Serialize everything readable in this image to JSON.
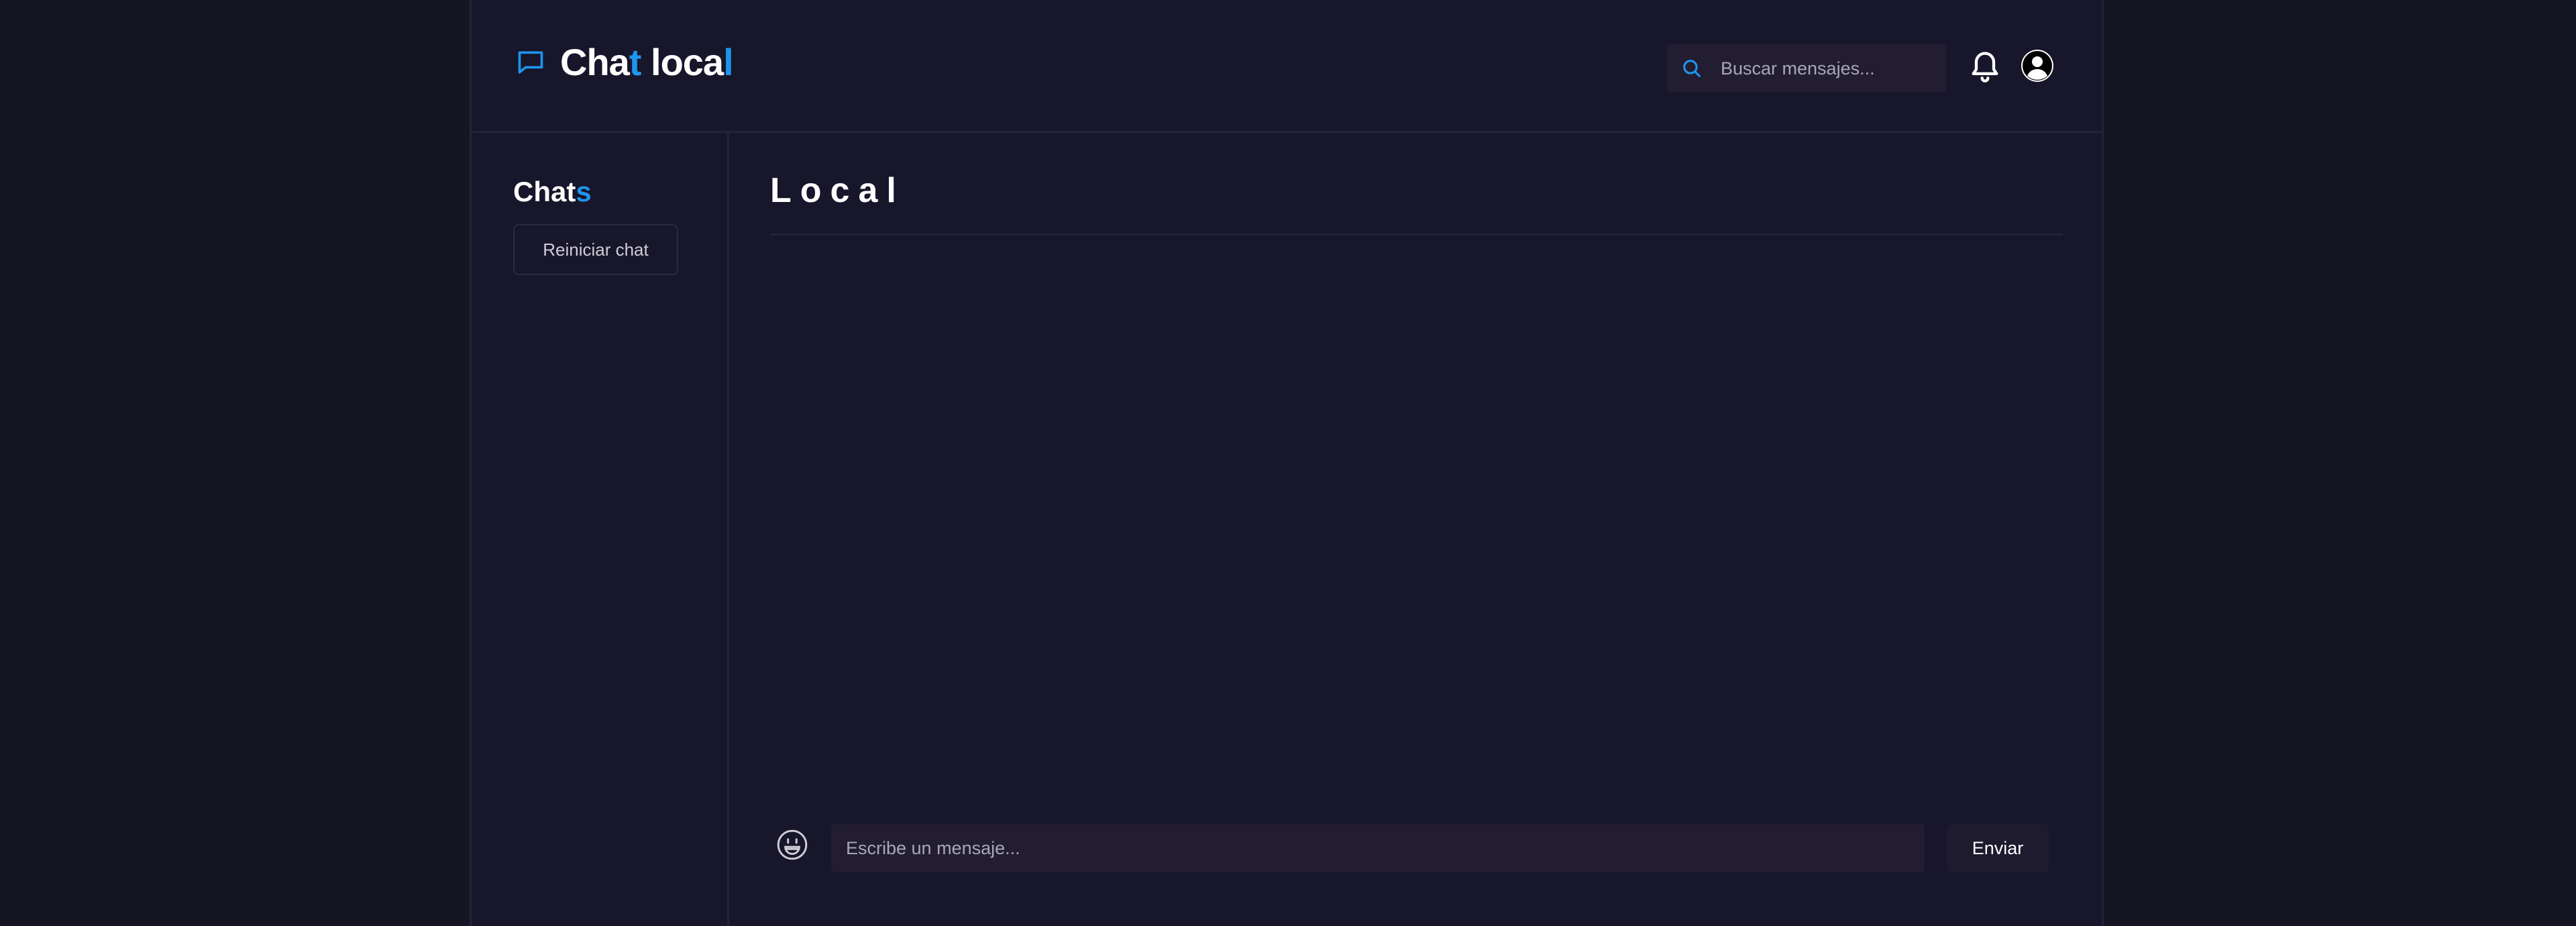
{
  "app": {
    "title_main": "Cha",
    "title_t": "t",
    "title_space": " ",
    "title_loca": "loca",
    "title_l": "l",
    "logo_icon": "chat-bubble-icon",
    "accent_color": "#1e95ec"
  },
  "header": {
    "search_placeholder": "Buscar mensajes...",
    "search_icon": "search-icon",
    "bell_icon": "bell-icon",
    "avatar_icon": "user-avatar-icon"
  },
  "sidebar": {
    "title_main": "Chat",
    "title_accent": "s",
    "reset_label": "Reiniciar chat"
  },
  "chat": {
    "room_title": "Local",
    "message_placeholder": "Escribe un mensaje...",
    "send_label": "Enviar",
    "emoji_icon": "emoji-icon"
  }
}
